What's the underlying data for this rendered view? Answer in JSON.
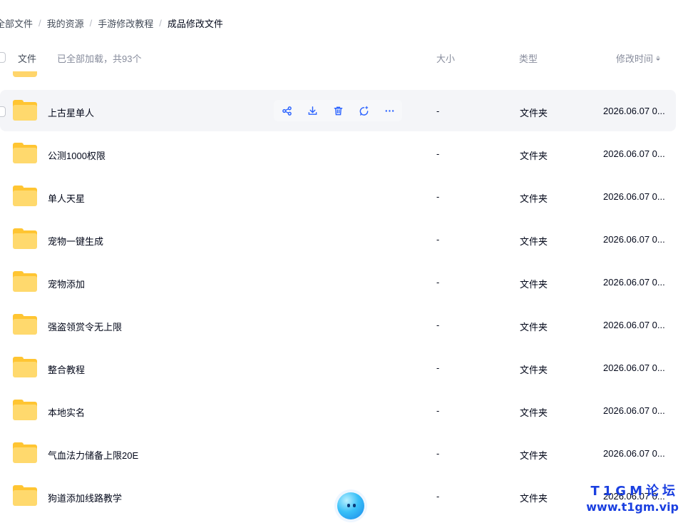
{
  "breadcrumb": {
    "items": [
      "全部文件",
      "我的资源",
      "手游修改教程",
      "成品修改文件"
    ],
    "separator": "/"
  },
  "header": {
    "name_label": "文件",
    "loaded_text": "已全部加载，共93个",
    "size_label": "大小",
    "type_label": "类型",
    "time_label": "修改时间"
  },
  "files": [
    {
      "name": "上古星单人",
      "size": "-",
      "type": "文件夹",
      "time": "2026.06.07 0..."
    },
    {
      "name": "公测1000权限",
      "size": "-",
      "type": "文件夹",
      "time": "2026.06.07 0..."
    },
    {
      "name": "单人天星",
      "size": "-",
      "type": "文件夹",
      "time": "2026.06.07 0..."
    },
    {
      "name": "宠物一键生成",
      "size": "-",
      "type": "文件夹",
      "time": "2026.06.07 0..."
    },
    {
      "name": "宠物添加",
      "size": "-",
      "type": "文件夹",
      "time": "2026.06.07 0..."
    },
    {
      "name": "强盗领赏令无上限",
      "size": "-",
      "type": "文件夹",
      "time": "2026.06.07 0..."
    },
    {
      "name": "整合教程",
      "size": "-",
      "type": "文件夹",
      "time": "2026.06.07 0..."
    },
    {
      "name": "本地实名",
      "size": "-",
      "type": "文件夹",
      "time": "2026.06.07 0..."
    },
    {
      "name": "气血法力储备上限20E",
      "size": "-",
      "type": "文件夹",
      "time": "2026.06.07 0..."
    },
    {
      "name": "狗道添加线路教学",
      "size": "-",
      "type": "文件夹",
      "time": "2026.06.07 0..."
    }
  ],
  "row_actions": [
    "share-icon",
    "download-icon",
    "delete-icon",
    "ai-chat-icon",
    "more-icon"
  ],
  "watermark": {
    "title": "T1GM论坛",
    "url": "www.t1gm.vip"
  },
  "colors": {
    "accent": "#2b63ff",
    "folder": "#ffc532",
    "hover_row": "#f4f5f8",
    "watermark": "#1a3fe0"
  }
}
